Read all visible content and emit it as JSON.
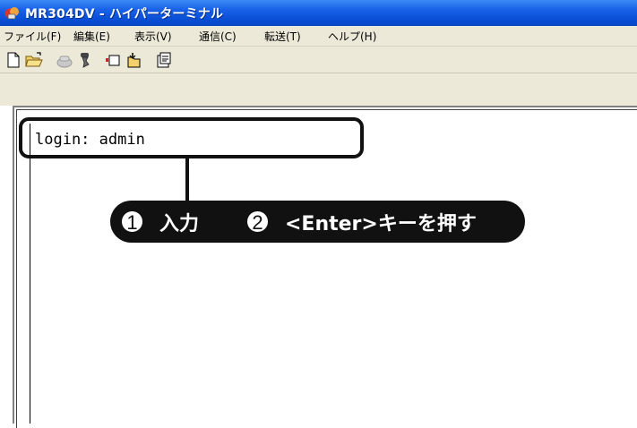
{
  "window": {
    "title": "MR304DV - ハイパーターミナル",
    "icon": "hyperterminal-app-icon"
  },
  "menu": {
    "items": [
      {
        "label": "ファイル(F)"
      },
      {
        "label": "編集(E)"
      },
      {
        "label": "表示(V)"
      },
      {
        "label": "通信(C)"
      },
      {
        "label": "転送(T)"
      },
      {
        "label": "ヘルプ(H)"
      }
    ]
  },
  "toolbar": {
    "buttons": [
      "new-icon",
      "open-icon",
      "connect-icon",
      "disconnect-icon",
      "send-icon",
      "receive-icon",
      "properties-icon"
    ]
  },
  "terminal": {
    "line1": "login: admin"
  },
  "callout": {
    "step1_num": "1",
    "step1_label": "入力",
    "step2_num": "2",
    "step2_label": "<Enter>キーを押す"
  },
  "colors": {
    "titlebar": "#0a50d8",
    "chrome": "#ece9d8",
    "callout": "#111111"
  }
}
